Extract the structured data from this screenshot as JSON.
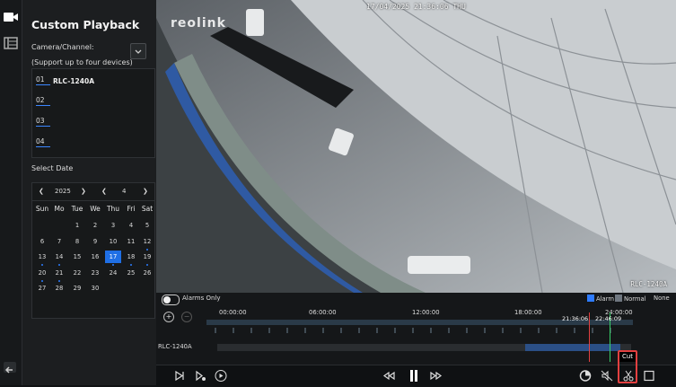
{
  "panel": {
    "title": "Custom Playback",
    "camera_label": "Camera/Channel:",
    "support_note": "(Support up to four devices)",
    "channels": [
      {
        "num": "01",
        "name": "RLC-1240A"
      },
      {
        "num": "02",
        "name": ""
      },
      {
        "num": "03",
        "name": ""
      },
      {
        "num": "04",
        "name": ""
      }
    ],
    "select_date_label": "Select Date"
  },
  "calendar": {
    "year": "2025",
    "month": "4",
    "weekdays": [
      "Sun",
      "Mo",
      "Tue",
      "We",
      "Thu",
      "Fri",
      "Sat"
    ],
    "weeks": [
      [
        "",
        "",
        "1",
        "2",
        "3",
        "4",
        "5"
      ],
      [
        "6",
        "7",
        "8",
        "9",
        "10",
        "11",
        "12"
      ],
      [
        "13",
        "14",
        "15",
        "16",
        "17",
        "18",
        "19"
      ],
      [
        "20",
        "21",
        "22",
        "23",
        "24",
        "25",
        "26"
      ],
      [
        "27",
        "28",
        "29",
        "30",
        "",
        "",
        ""
      ]
    ],
    "selected": "17",
    "dots": [
      "12",
      "13",
      "14",
      "17",
      "18",
      "19",
      "20",
      "21"
    ]
  },
  "video": {
    "osd_time": "17/04/2025 21:36:06 THU",
    "logo": "reolink",
    "camera_name": "RLC-1240A"
  },
  "timeline": {
    "alarms_only_label": "Alarms Only",
    "legend": [
      {
        "label": "Alarm",
        "color": "#2e7bff"
      },
      {
        "label": "Normal",
        "color": "#6f7780"
      },
      {
        "label": "None",
        "color": ""
      }
    ],
    "ticks": [
      "00:00:00",
      "06:00:00",
      "12:00:00",
      "18:00:00",
      "24:00:00"
    ],
    "track_label": "RLC-1240A",
    "cursor_time": "21:36:06",
    "cut_time": "22:46:09",
    "tooltip": "Cut"
  },
  "colors": {
    "accent": "#1f6fe5",
    "cursor_red": "#e34040",
    "cursor_green": "#38d06a"
  }
}
